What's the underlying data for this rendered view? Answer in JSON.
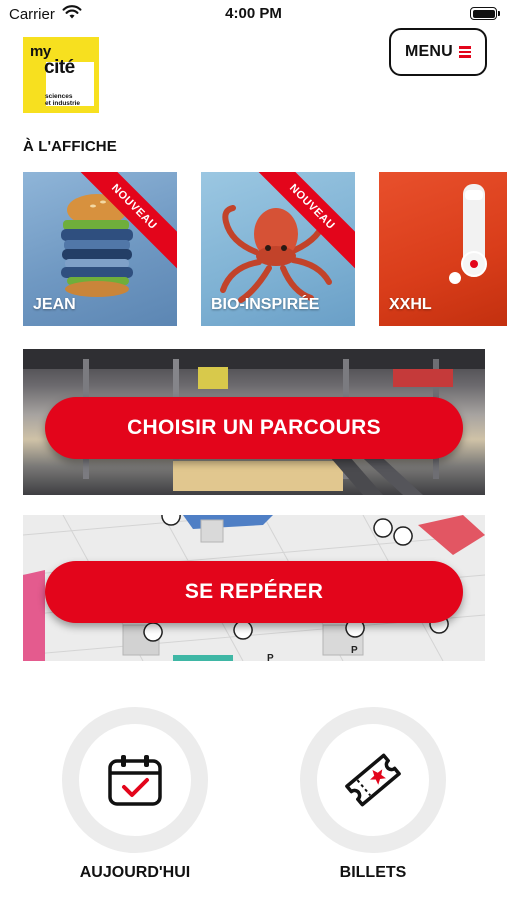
{
  "status_bar": {
    "carrier": "Carrier",
    "time": "4:00 PM",
    "battery_level": 1.0
  },
  "header": {
    "logo": {
      "line1": "my",
      "line2": "cité",
      "line3": "sciences",
      "line4": "et industrie"
    },
    "menu_label": "MENU",
    "menu_icon": "hamburger-icon"
  },
  "expos": {
    "title": "À L'AFFICHE",
    "items": [
      {
        "label": "JEAN",
        "badge": "NOUVEAU"
      },
      {
        "label": "BIO-INSPIRÉE",
        "badge": "NOUVEAU"
      },
      {
        "label": "XXHL",
        "badge": ""
      }
    ]
  },
  "actions": {
    "route_label": "CHOISIR UN PARCOURS",
    "map_label": "SE REPÉRER"
  },
  "shortcuts": [
    {
      "label": "AUJOURD'HUI",
      "icon": "calendar-check-icon"
    },
    {
      "label": "BILLETS",
      "icon": "ticket-star-icon"
    }
  ],
  "colors": {
    "accent": "#e3051b",
    "logo_yellow": "#f7e01f",
    "ring_gray": "#ececec"
  }
}
